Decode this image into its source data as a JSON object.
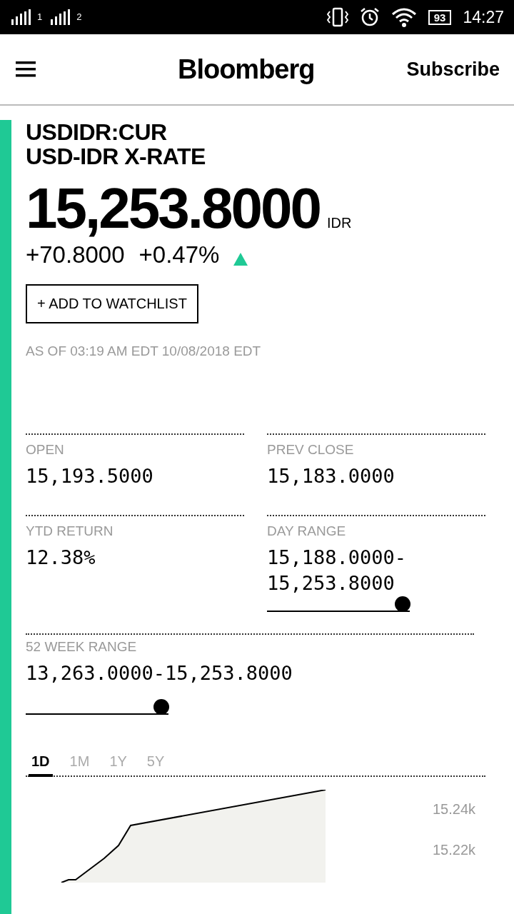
{
  "status_bar": {
    "sim_1": "1",
    "sim_2": "2",
    "battery": "93",
    "time": "14:27"
  },
  "header": {
    "logo": "Bloomberg",
    "subscribe": "Subscribe"
  },
  "quote": {
    "ticker": "USDIDR:CUR",
    "name": "USD-IDR X-RATE",
    "price": "15,253.8000",
    "currency": "IDR",
    "change": "+70.8000",
    "change_pct": "+0.47%",
    "rising": true,
    "watchlist_button": "+ ADD TO WATCHLIST",
    "as_of": "AS OF 03:19 AM EDT 10/08/2018 EDT"
  },
  "stats": [
    {
      "label": "OPEN",
      "value": "15,193.5000"
    },
    {
      "label": "PREV CLOSE",
      "value": "15,183.0000"
    },
    {
      "label": "YTD RETURN",
      "value": "12.38%"
    },
    {
      "label": "DAY RANGE",
      "value": "15,188.0000-15,253.8000",
      "level": 0.95
    }
  ],
  "week_range": {
    "label": "52 WEEK RANGE",
    "value": "13,263.0000-15,253.8000",
    "level": 0.95
  },
  "chart": {
    "tabs": [
      {
        "label": "1D",
        "selected": true
      },
      {
        "label": "1M",
        "selected": false
      },
      {
        "label": "1Y",
        "selected": false
      },
      {
        "label": "5Y",
        "selected": false
      }
    ],
    "y_labels": [
      "15.24k",
      "15.22k"
    ]
  }
}
